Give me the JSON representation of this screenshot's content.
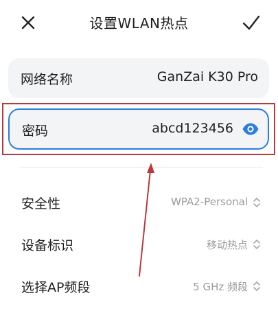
{
  "header": {
    "title": "设置WLAN热点",
    "close_icon": "close-icon",
    "confirm_icon": "check-icon"
  },
  "network_name": {
    "label": "网络名称",
    "value": "GanZai K30 Pro"
  },
  "password": {
    "label": "密码",
    "value": "abcd123456",
    "visibility_icon": "eye-icon"
  },
  "settings": [
    {
      "label": "安全性",
      "value": "WPA2-Personal"
    },
    {
      "label": "设备标识",
      "value": "移动热点"
    },
    {
      "label": "选择AP频段",
      "value": "5 GHz 频段"
    }
  ],
  "colors": {
    "accent": "#2a7de1",
    "annotation": "#b83a3e",
    "card_bg": "#f3f4f6",
    "secondary_text": "#9a9a9a"
  }
}
